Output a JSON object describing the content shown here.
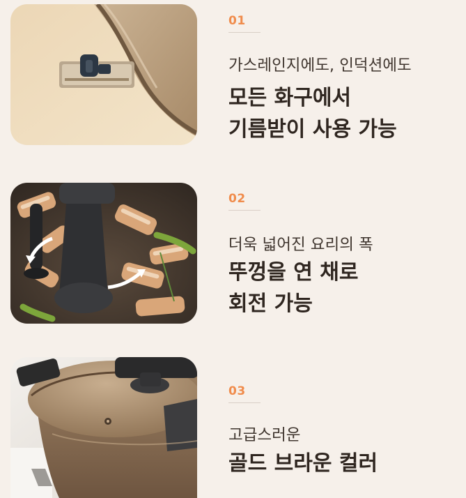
{
  "theme": {
    "background": "#f6f0ea",
    "accent": "#f08c4c",
    "text_dark": "#2f2620"
  },
  "features": [
    {
      "number": "01",
      "subtitle": "가스레인지에도, 인덕션에도",
      "headline_lines": [
        "모든 화구에서",
        "기름받이 사용 가능"
      ],
      "image": "pan-with-drip-tray-handle"
    },
    {
      "number": "02",
      "subtitle": "더욱 넓어진 요리의 폭",
      "headline_lines": [
        "뚜껑을 연 채로",
        "회전 가능"
      ],
      "image": "rotating-lid-handle-over-pork-belly"
    },
    {
      "number": "03",
      "subtitle": "고급스러운",
      "headline_lines": [
        "골드 브라운 컬러"
      ],
      "image": "gold-brown-pressure-pan"
    }
  ]
}
